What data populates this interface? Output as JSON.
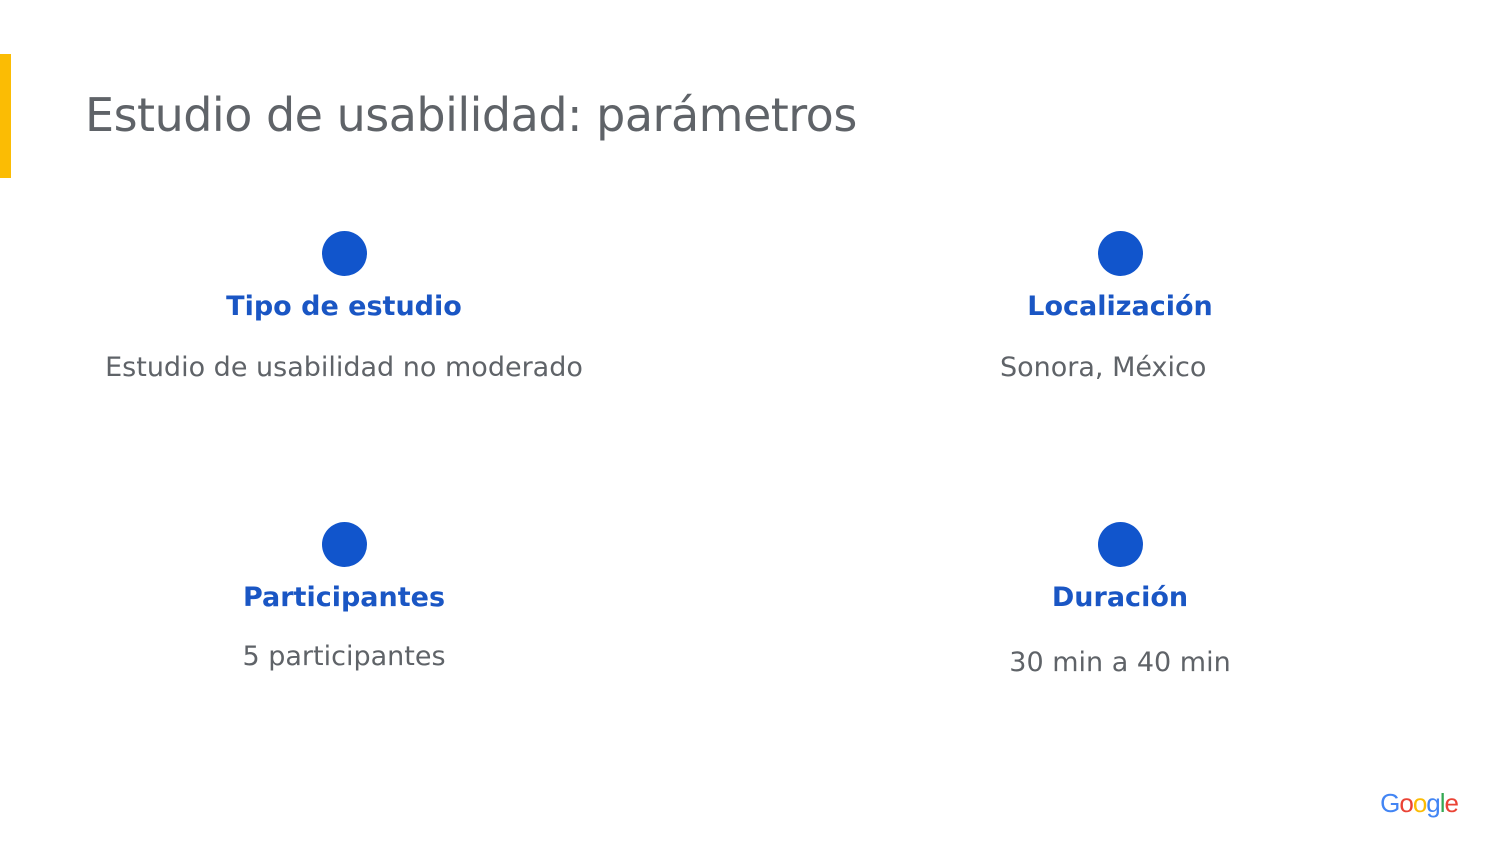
{
  "slide": {
    "title": "Estudio de usabilidad: parámetros",
    "accent_color": "#fbbc04",
    "dot_color": "#1155cc"
  },
  "parameters": [
    {
      "label": "Tipo de estudio",
      "value": "Estudio de usabilidad no moderado"
    },
    {
      "label": "Localización",
      "value": "Sonora, México"
    },
    {
      "label": "Participantes",
      "value": "5 participantes"
    },
    {
      "label": "Duración",
      "value": "30 min a 40 min"
    }
  ],
  "logo": {
    "text": "Google",
    "letters": [
      "G",
      "o",
      "o",
      "g",
      "l",
      "e"
    ],
    "colors": [
      "#4285f4",
      "#ea4335",
      "#fbbc05",
      "#4285f4",
      "#34a853",
      "#ea4335"
    ]
  }
}
